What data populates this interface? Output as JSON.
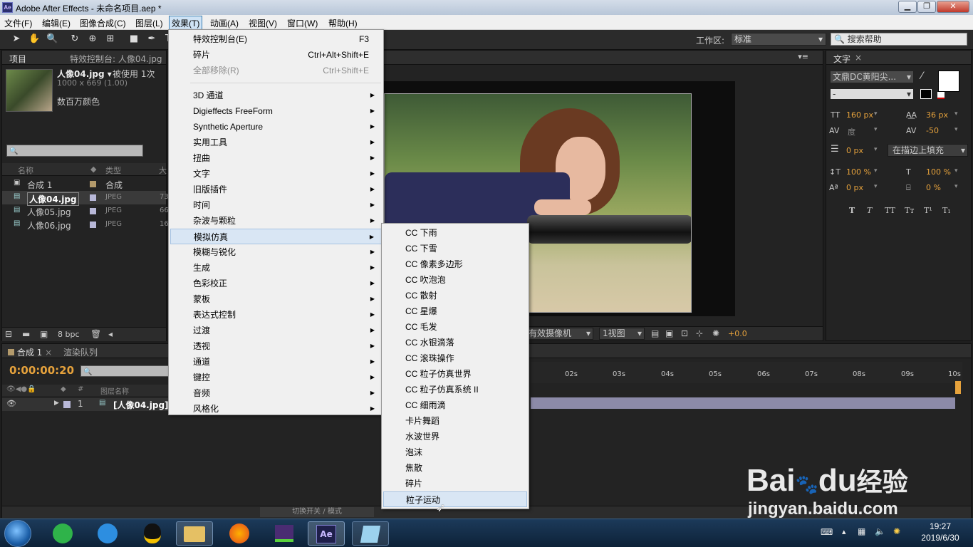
{
  "window": {
    "title": "Adobe After Effects - 未命名项目.aep *",
    "app_icon": "Ae"
  },
  "window_controls": {
    "minimize": "▁",
    "maximize": "❐",
    "close": "✕"
  },
  "menubar": [
    "文件(F)",
    "编辑(E)",
    "图像合成(C)",
    "图层(L)",
    "效果(T)",
    "动画(A)",
    "视图(V)",
    "窗口(W)",
    "帮助(H)"
  ],
  "toolbar": {
    "workspace_label": "工作区:",
    "workspace_value": "标准",
    "search_help": "搜索帮助"
  },
  "project_panel": {
    "tab_project": "项目",
    "tab_effect_controls": "特效控制台: 人像04.jpg",
    "asset_name": "人像04.jpg ▾",
    "asset_usage": "被使用 1次",
    "asset_dims": "1000 x 669 (1.00)",
    "asset_color": "数百万颜色",
    "columns": {
      "name": "名称",
      "type": "类型",
      "size": "大"
    },
    "items": [
      {
        "name": "合成 1",
        "type": "合成",
        "size": ""
      },
      {
        "name": "人像04.jpg",
        "type": "JPEG",
        "size": "73"
      },
      {
        "name": "人像05.jpg",
        "type": "JPEG",
        "size": "66"
      },
      {
        "name": "人像06.jpg",
        "type": "JPEG",
        "size": "16"
      }
    ],
    "bpc": "8 bpc"
  },
  "comp_viewer": {
    "camera": "有效摄像机",
    "views": "1视图",
    "exposure": "+0.0"
  },
  "text_panel": {
    "tab": "文字",
    "font": "文鼎DC黄阳尖...",
    "style": "-",
    "size": "160 px",
    "leading": "36 px",
    "kerning": "度",
    "tracking": "-50",
    "stroke_width": "0 px",
    "stroke_mode": "在描边上填充",
    "vscale": "100 %",
    "hscale": "100 %",
    "baseline": "0 px",
    "tsume": "0 %",
    "style_buttons": [
      "T",
      "T",
      "TT",
      "Tт",
      "T¹",
      "T₁"
    ]
  },
  "timeline": {
    "tab_comp": "合成 1",
    "tab_render": "渲染队列",
    "timecode": "0:00:00:20",
    "col_layer_name": "图层名称",
    "col_num": "#",
    "layer_num": "1",
    "layer_name": "[人像04.jpg]",
    "ruler": [
      "02s",
      "03s",
      "04s",
      "05s",
      "06s",
      "07s",
      "08s",
      "09s",
      "10s"
    ],
    "switch_mode": "切换开关 / 模式"
  },
  "effects_menu": [
    {
      "label": "特效控制台(E)",
      "shortcut": "F3",
      "sub": false,
      "disabled": false
    },
    {
      "label": "碎片",
      "shortcut": "Ctrl+Alt+Shift+E",
      "sub": false,
      "disabled": false
    },
    {
      "label": "全部移除(R)",
      "shortcut": "Ctrl+Shift+E",
      "sub": false,
      "disabled": true
    },
    {
      "label": "3D 通道",
      "sub": true
    },
    {
      "label": "Digieffects FreeForm",
      "sub": true
    },
    {
      "label": "Synthetic Aperture",
      "sub": true
    },
    {
      "label": "实用工具",
      "sub": true
    },
    {
      "label": "扭曲",
      "sub": true
    },
    {
      "label": "文字",
      "sub": true
    },
    {
      "label": "旧版插件",
      "sub": true
    },
    {
      "label": "时间",
      "sub": true
    },
    {
      "label": "杂波与颗粒",
      "sub": true
    },
    {
      "label": "模拟仿真",
      "sub": true,
      "highlighted": true
    },
    {
      "label": "模糊与锐化",
      "sub": true
    },
    {
      "label": "生成",
      "sub": true
    },
    {
      "label": "色彩校正",
      "sub": true
    },
    {
      "label": "蒙板",
      "sub": true
    },
    {
      "label": "表达式控制",
      "sub": true
    },
    {
      "label": "过渡",
      "sub": true
    },
    {
      "label": "透视",
      "sub": true
    },
    {
      "label": "通道",
      "sub": true
    },
    {
      "label": "键控",
      "sub": true
    },
    {
      "label": "音频",
      "sub": true
    },
    {
      "label": "风格化",
      "sub": true
    }
  ],
  "simulation_submenu": [
    "CC 下雨",
    "CC 下雪",
    "CC 像素多边形",
    "CC 吹泡泡",
    "CC 散射",
    "CC 星爆",
    "CC 毛发",
    "CC 水银滴落",
    "CC 滚珠操作",
    "CC 粒子仿真世界",
    "CC 粒子仿真系统 II",
    "CC 细雨滴",
    "卡片舞蹈",
    "水波世界",
    "泡沫",
    "焦散",
    "碎片",
    "粒子运动"
  ],
  "submenu_highlight_index": 17,
  "taskbar": {
    "time": "19:27",
    "date": "2019/6/30"
  },
  "watermark": {
    "brand": "Bai",
    "brand2": "du",
    "cn": "经验",
    "url": "jingyan.baidu.com"
  }
}
